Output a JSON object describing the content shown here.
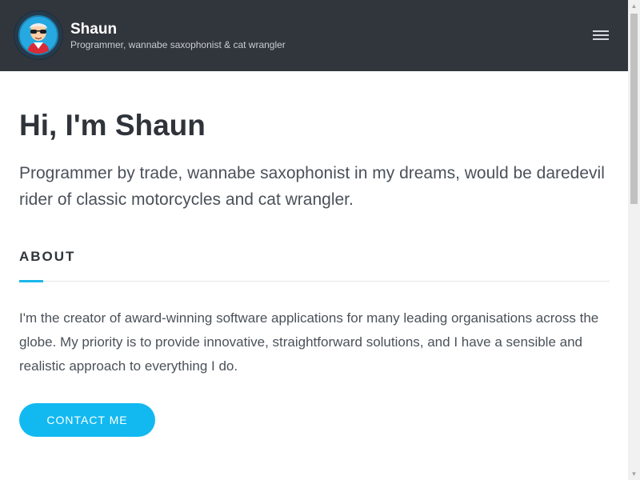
{
  "header": {
    "site_name": "Shaun",
    "tagline": "Programmer, wannabe saxophonist & cat wrangler",
    "avatar_icon": "cartoon-avatar-with-sunglasses",
    "menu_icon": "hamburger-menu-icon"
  },
  "hero": {
    "title": "Hi, I'm Shaun",
    "subtitle": "Programmer by trade, wannabe saxophonist in my dreams, would be daredevil rider of classic motorcycles and cat wrangler."
  },
  "about": {
    "heading": "ABOUT",
    "text": "I'm the creator of award-winning software applications for many leading organisations across the globe. My priority is to provide innovative, straightforward solutions, and I have a sensible and realistic approach to everything I do."
  },
  "cta": {
    "contact_label": "CONTACT ME"
  },
  "scrollbar": {
    "up_arrow": "▲",
    "down_arrow": "▼"
  },
  "colors": {
    "header_bg": "#31363d",
    "accent": "#1ab7ea",
    "button_bg": "#12b9f0",
    "heading_text": "#2f343a",
    "body_text": "#4b5159"
  }
}
